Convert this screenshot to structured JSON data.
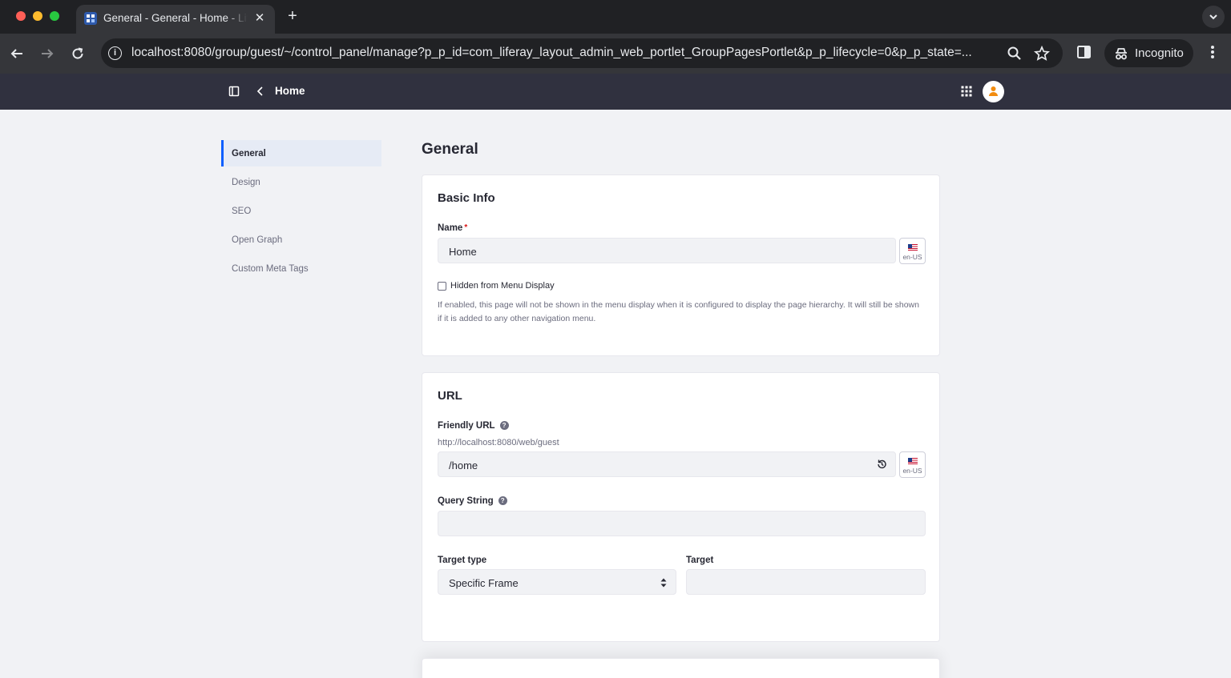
{
  "browser": {
    "tab_title": "General - General - Home - Liferay",
    "tab_close": "✕",
    "new_tab": "+",
    "url": "localhost:8080/group/guest/~/control_panel/manage?p_p_id=com_liferay_layout_admin_web_portlet_GroupPagesPortlet&p_p_lifecycle=0&p_p_state=...",
    "incognito_label": "Incognito"
  },
  "header": {
    "title": "Home"
  },
  "side_nav": {
    "items": [
      {
        "label": "General",
        "active": true
      },
      {
        "label": "Design",
        "active": false
      },
      {
        "label": "SEO",
        "active": false
      },
      {
        "label": "Open Graph",
        "active": false
      },
      {
        "label": "Custom Meta Tags",
        "active": false
      }
    ]
  },
  "main": {
    "heading": "General",
    "basic_info": {
      "title": "Basic Info",
      "name_label": "Name",
      "required_mark": "*",
      "name_value": "Home",
      "lang_code": "en-US",
      "hidden_label": "Hidden from Menu Display",
      "hidden_checked": false,
      "hidden_help": "If enabled, this page will not be shown in the menu display when it is configured to display the page hierarchy. It will still be shown if it is added to any other navigation menu."
    },
    "url_section": {
      "title": "URL",
      "friendly_url_label": "Friendly URL",
      "friendly_url_prefix": "http://localhost:8080/web/guest",
      "friendly_url_value": "/home",
      "lang_code": "en-US",
      "query_string_label": "Query String",
      "query_string_value": "",
      "target_type_label": "Target type",
      "target_type_value": "Specific Frame",
      "target_label": "Target",
      "target_value": ""
    }
  },
  "icons": {
    "help": "?"
  },
  "colors": {
    "accent": "#0b5fff",
    "header_bg": "#30313f",
    "required": "#da1414",
    "avatar_accent": "#f28c0f"
  }
}
